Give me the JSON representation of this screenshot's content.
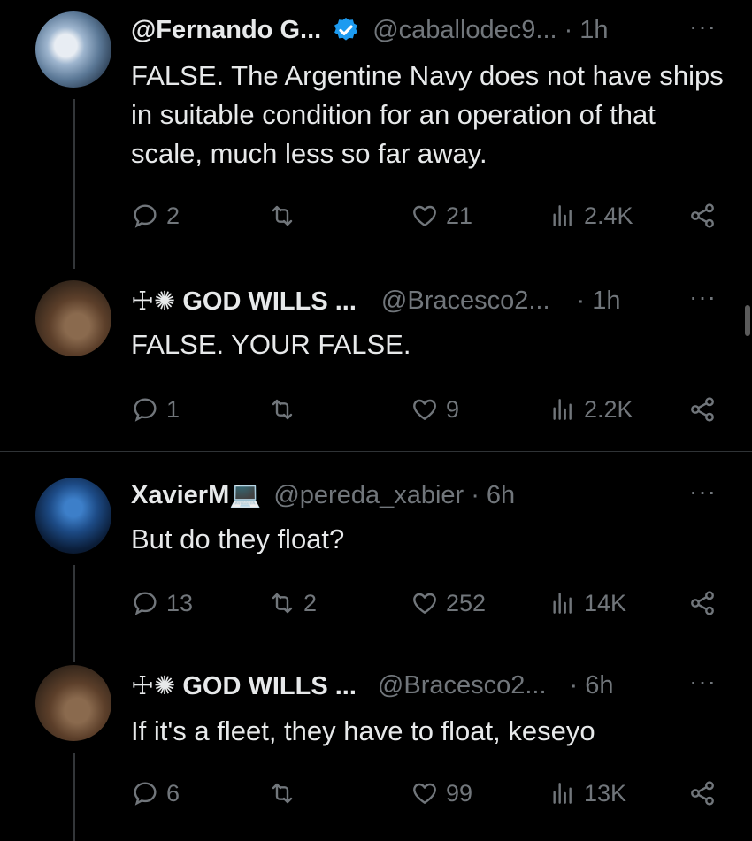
{
  "tweets": [
    {
      "name": "@Fernando G...",
      "verified": true,
      "handle": "@caballodec9...",
      "dot": "·",
      "time": "1h",
      "more": "···",
      "text": "FALSE. The Argentine Navy does not have ships in suitable condition for an operation of that scale, much less so far away.",
      "replies": "2",
      "reposts": "",
      "likes": "21",
      "views": "2.4K"
    },
    {
      "name": "☩✺ GOD WILLS ...",
      "verified": false,
      "handle": "@Bracesco2...",
      "dot": "·",
      "time": "1h",
      "more": "···",
      "text": "FALSE. YOUR FALSE.",
      "replies": "1",
      "reposts": "",
      "likes": "9",
      "views": "2.2K"
    },
    {
      "name": "XavierM💻",
      "verified": false,
      "handle": "@pereda_xabier",
      "dot": "·",
      "time": "6h",
      "more": "···",
      "text": "But do they float?",
      "replies": "13",
      "reposts": "2",
      "likes": "252",
      "views": "14K"
    },
    {
      "name": "☩✺ GOD WILLS ...",
      "verified": false,
      "handle": "@Bracesco2...",
      "dot": "·",
      "time": "6h",
      "more": "···",
      "text": "If it's a fleet, they have to float, keseyo",
      "replies": "6",
      "reposts": "",
      "likes": "99",
      "views": "13K"
    }
  ],
  "icons": {
    "reply": "reply-icon",
    "repost": "repost-icon",
    "like": "heart-icon",
    "views": "views-icon",
    "share": "share-icon",
    "verified": "verified-badge-icon"
  },
  "colors": {
    "background": "#000000",
    "text": "#e7e9ea",
    "muted": "#71767b",
    "verified": "#1d9bf0"
  }
}
